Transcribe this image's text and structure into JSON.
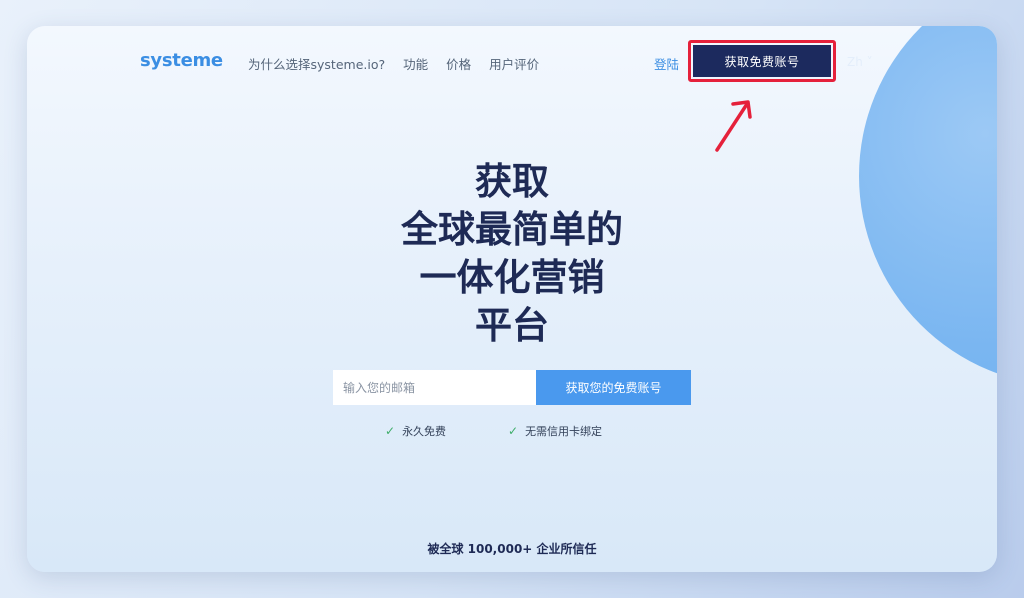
{
  "nav": {
    "logo": "systeme",
    "links": [
      "为什么选择systeme.io?",
      "功能",
      "价格",
      "用户评价"
    ],
    "login": "登陆",
    "cta": "获取免费账号",
    "language": "Zh"
  },
  "hero": {
    "title_lines": [
      "获取",
      "全球最简单的",
      "一体化营销",
      "平台"
    ]
  },
  "signup": {
    "email_placeholder": "输入您的邮箱",
    "button": "获取您的免费账号"
  },
  "benefits": [
    "永久免费",
    "无需信用卡绑定"
  ],
  "trusted": "被全球 100,000+ 企业所信任",
  "colors": {
    "brand": "#3b8ee3",
    "cta_bg": "#1c2a5e",
    "highlight": "#e5213b",
    "signup_button": "#4a99ee",
    "check": "#3fae6a"
  }
}
